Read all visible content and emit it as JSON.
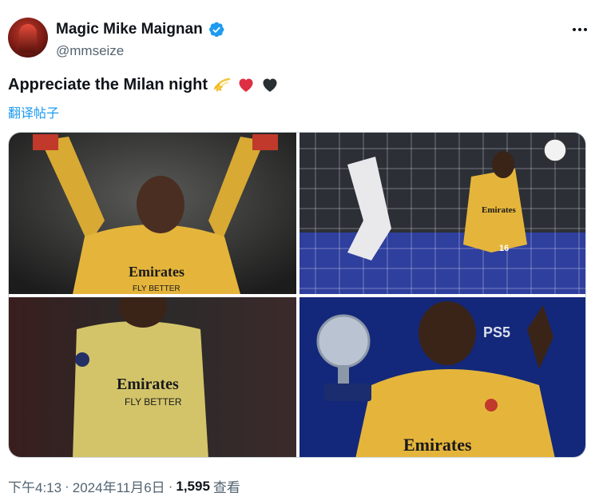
{
  "author": {
    "display_name": "Magic Mike Maignan",
    "handle": "@mmseize"
  },
  "tweet": {
    "text": "Appreciate the Milan night",
    "emojis": [
      "dizzy-star-emoji",
      "red-heart-emoji",
      "black-heart-emoji"
    ],
    "translate_label": "翻译帖子"
  },
  "media": {
    "photos": [
      {
        "description_icon": "goalkeeper-celebrating-photo",
        "jersey_text": "Emirates",
        "jersey_sub": "FLY BETTER"
      },
      {
        "description_icon": "goalkeeper-save-photo",
        "jersey_text": "Emirates",
        "number": "16"
      },
      {
        "description_icon": "goalkeeper-shouting-photo",
        "jersey_text": "Emirates",
        "jersey_sub": "FLY BETTER"
      },
      {
        "description_icon": "player-of-the-match-trophy-photo",
        "jersey_text": "Emirates",
        "sponsor": "PS5"
      }
    ]
  },
  "footer": {
    "time": "下午4:13",
    "date": "2024年11月6日",
    "views_count": "1,595",
    "views_label": "查看",
    "separator": "·"
  },
  "colors": {
    "accent": "#1d9bf0",
    "secondary_text": "#536471",
    "jersey_yellow": "#e8b93a"
  }
}
